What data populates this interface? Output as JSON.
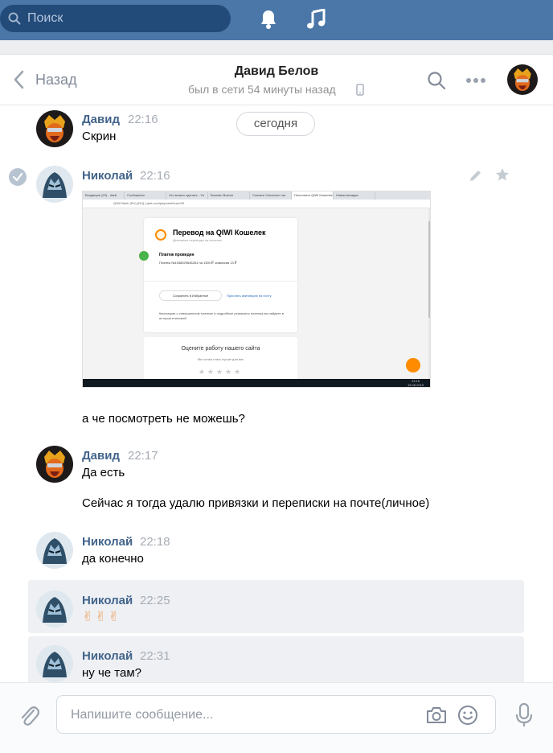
{
  "topbar": {
    "search_placeholder": "Поиск",
    "icons": [
      "search-icon",
      "bell-icon",
      "music-icon"
    ]
  },
  "header": {
    "back_label": "Назад",
    "peer_name": "Давид Белов",
    "peer_status": "был в сети 54 минуты назад",
    "icons": [
      "back-chevron-icon",
      "mobile-phone-icon",
      "search-icon",
      "more-icon",
      "avatar"
    ]
  },
  "date_separator": "сегодня",
  "messages": [
    {
      "author": "Давид",
      "time": "22:16",
      "text": "Скрин"
    },
    {
      "author": "Николай",
      "time": "22:16",
      "attachment": {
        "tabs": [
          "Входящие (23) - danil",
          "Сообщения",
          "Что можно сделать - Ya",
          "Bosnian Bosnia",
          "Скачать Cinnamon ma",
          "Пополнить QIWI Кошелёк",
          "Новая вкладка"
        ],
        "url": "QIWI Bank (RU) [RU] | qiwi.com/payment/form/99",
        "title": "Перевод на QIWI Кошелек",
        "subtitle": "Денежные переводы на кошелек",
        "status": "Платеж проведен",
        "details": "Платеж №1548029646281 на 1300 ₽, комиссия 13 ₽",
        "fav_button": "Сохранить в Избранное",
        "receipt_link": "Прислать квитанцию на почту",
        "note": "Квитанцию о совершенном платеже и подробные реквизиты платежа вы найдете в истории платежей",
        "rate_title": "Оцените работу нашего сайта",
        "rate_sub": "Мы хотим стать лучше для вас",
        "stars": "★★★★★",
        "clock_time": "23:16",
        "clock_date": "15.08.2019"
      },
      "text_after": "а че посмотреть не можешь?"
    },
    {
      "author": "Давид",
      "time": "22:17",
      "text": "Да есть",
      "text2": "Сейчас я тогда удалю привязки и переписки на почте(личное)"
    },
    {
      "author": "Николай",
      "time": "22:18",
      "text": "да конечно"
    },
    {
      "author": "Николай",
      "time": "22:25",
      "text": "✌✌✌"
    },
    {
      "author": "Николай",
      "time": "22:31",
      "text": "ну че там?"
    }
  ],
  "composer": {
    "placeholder": "Напишите сообщение...",
    "icons": [
      "attach-icon",
      "camera-icon",
      "emoji-icon",
      "microphone-icon"
    ]
  },
  "colors": {
    "topbar": "#4a76a8",
    "search_bg": "#224b7a",
    "author": "#42648b",
    "time": "#a7adb5",
    "highlight": "#eef0f4"
  }
}
